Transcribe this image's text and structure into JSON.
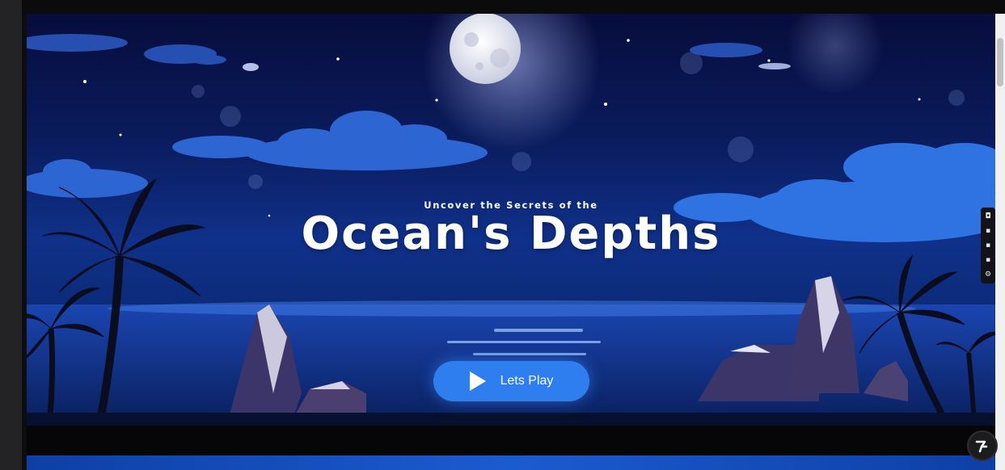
{
  "hero": {
    "subtitle": "Uncover the Secrets of the",
    "title": "Ocean's Depths"
  },
  "cta": {
    "label": "Lets Play",
    "icon": "play-icon"
  },
  "widget": {
    "icons": [
      "camera-icon",
      "square-icon",
      "square-icon",
      "square-icon",
      "gear-icon"
    ]
  },
  "colors": {
    "sky_top": "#070d3c",
    "sea": "#10318a",
    "button": "#2f7ef0",
    "text": "#ffffff"
  }
}
